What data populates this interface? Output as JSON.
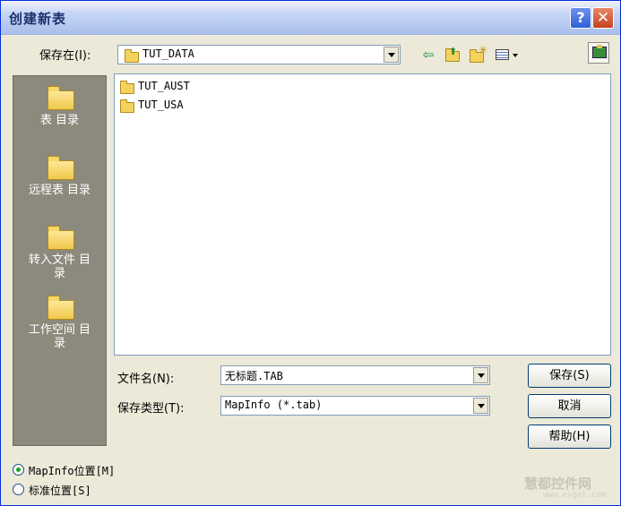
{
  "window": {
    "title": "创建新表"
  },
  "save_in": {
    "label": "保存在(I):",
    "value": "TUT_DATA"
  },
  "places": [
    {
      "line1": "表 目录",
      "line2": ""
    },
    {
      "line1": "远程表 目录",
      "line2": ""
    },
    {
      "line1": "转入文件 目",
      "line2": "录"
    },
    {
      "line1": "工作空间 目",
      "line2": "录"
    }
  ],
  "files": [
    "TUT_AUST",
    "TUT_USA"
  ],
  "filename": {
    "label": "文件名(N):",
    "value": "无标题.TAB"
  },
  "filetype": {
    "label": "保存类型(T):",
    "value": "MapInfo (*.tab)"
  },
  "buttons": {
    "save": "保存(S)",
    "cancel": "取消",
    "help": "帮助(H)"
  },
  "location": {
    "mapinfo": "MapInfo位置[M]",
    "standard": "标准位置[S]",
    "selected": "mapinfo"
  },
  "watermark": {
    "text": "慧都控件网",
    "url": "www.evget.com"
  },
  "colors": {
    "accent": "#0831D9",
    "places_bg": "#8C8A7D",
    "dialog_bg": "#ECE9D8"
  }
}
